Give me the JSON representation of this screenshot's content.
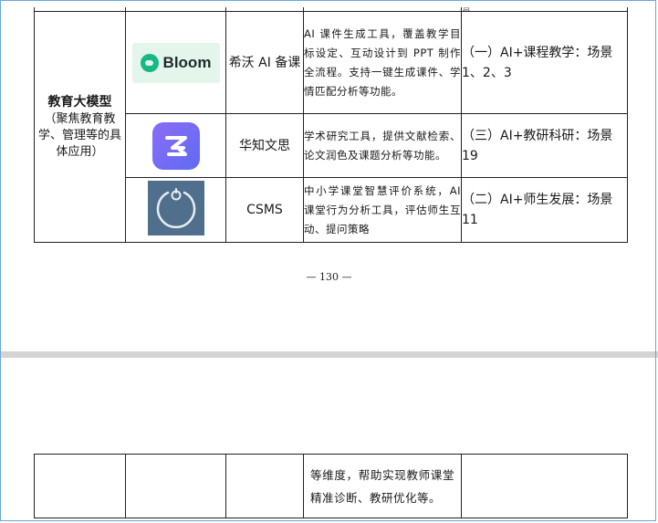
{
  "row_top": {
    "scene": "景"
  },
  "category": {
    "title": "教育大模型",
    "subtitle": "（聚焦教育教学、管理等的具体应用）"
  },
  "tools": [
    {
      "logo_text": "Bloom",
      "name": "希沃 AI 备课",
      "desc": "AI 课件生成工具，覆盖教学目标设定、互动设计到 PPT 制作全流程。支持一键生成课件、学情匹配分析等功能。",
      "scene": "（一）AI+课程教学：场景 1、2、3"
    },
    {
      "logo_text": "",
      "name": "华知文思",
      "desc": "学术研究工具，提供文献检索、论文润色及课题分析等功能。",
      "scene": "（三）AI+教研科研：场景 19"
    },
    {
      "logo_text": "",
      "name": "CSMS",
      "desc": "中小学课堂智慧评价系统，AI 课堂行为分析工具，评估师生互动、提问策略",
      "scene": "（二）AI+师生发展：场景 11"
    }
  ],
  "page_number": "— 130 —",
  "continuation": {
    "desc": "等维度，帮助实现教师课堂精准诊断、教研优化等。"
  },
  "colors": {
    "frame": "#6aa7d8",
    "bloom_green": "#17b883",
    "hz_purple": "#7b6cf5",
    "csms_bg": "#4f6f8c"
  }
}
